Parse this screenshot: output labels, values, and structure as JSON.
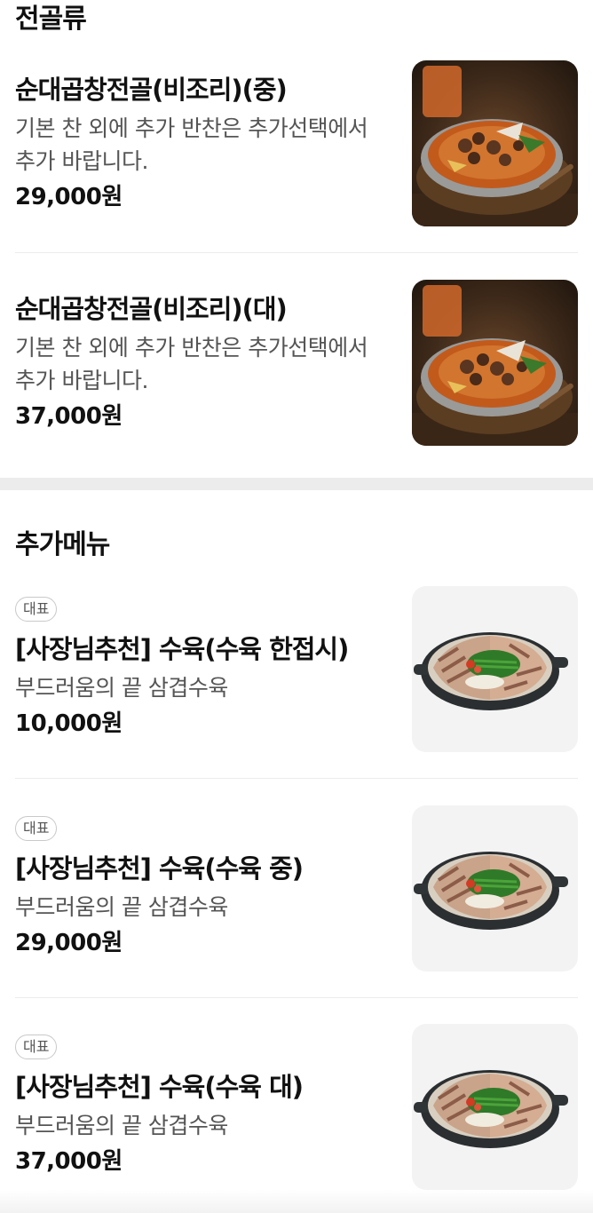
{
  "sections": [
    {
      "title": "전골류",
      "items": [
        {
          "name": "순대곱창전골(비조리)(중)",
          "desc_line1": "기본 찬 외에 추가 반찬은 추가선택에서",
          "desc_line2": "추가 바랍니다.",
          "price": "29,000원"
        },
        {
          "name": "순대곱창전골(비조리)(대)",
          "desc_line1": "기본 찬 외에 추가 반찬은 추가선택에서",
          "desc_line2": "추가 바랍니다.",
          "price": "37,000원"
        }
      ]
    },
    {
      "title": "추가메뉴",
      "items": [
        {
          "badge": "대표",
          "name": "[사장님추천] 수육(수육 한접시)",
          "desc": "부드러움의 끝 삼겹수육",
          "price": "10,000원"
        },
        {
          "badge": "대표",
          "name": "[사장님추천] 수육(수육 중)",
          "desc": "부드러움의 끝 삼겹수육",
          "price": "29,000원"
        },
        {
          "badge": "대표",
          "name": "[사장님추천] 수육(수육 대)",
          "desc": "부드러움의 끝 삼겹수육",
          "price": "37,000원"
        }
      ]
    }
  ],
  "icons": {
    "stew_photo": "hotpot-photo",
    "pork_photo": "boiled-pork-photo"
  }
}
